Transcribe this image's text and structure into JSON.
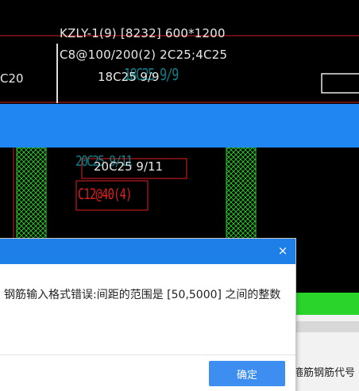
{
  "cad": {
    "beam_label_1": "KZLY-1(9) [8232] 600*1200",
    "beam_label_2": "C8@100/200(2) 2C25;4C25",
    "beam_label_3": "18C25 9/9",
    "left_label": "C20",
    "ghost_label_1": "18C25 9/9",
    "ghost_label_2": "20C25 9/11",
    "selected_label_1": "20C25 9/11",
    "selected_label_2": "C12@40(4)",
    "colors": {
      "band_blue": "#1f86f2",
      "hatch_green": "#2bd42b",
      "selection_red": "#e02020",
      "ghost_teal": "#0f7d86"
    }
  },
  "side_panel": {
    "column_header": "箍筋钢筋代号"
  },
  "dialog": {
    "close_icon": "×",
    "message": "钢筋输入格式错误:间距的范围是 [50,5000] 之间的整数",
    "ok_label": "确定"
  }
}
